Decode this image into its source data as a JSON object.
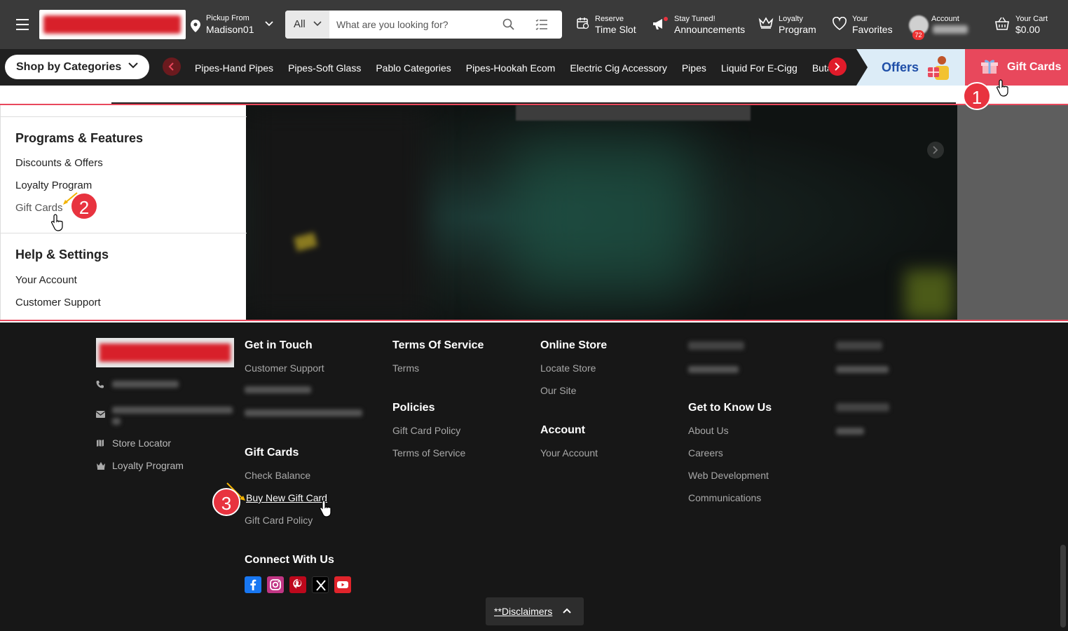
{
  "header": {
    "pickup_small": "Pickup From",
    "pickup_location": "Madison01",
    "search_category": "All",
    "search_placeholder": "What are you looking for?",
    "reserve_l1": "Reserve",
    "reserve_l2": "Time Slot",
    "announce_l1": "Stay Tuned!",
    "announce_l2": "Announcements",
    "loyalty_l1": "Loyalty",
    "loyalty_l2": "Program",
    "favorites_l1": "Your",
    "favorites_l2": "Favorites",
    "account_l1": "Account",
    "account_badge": "72",
    "cart_l1": "Your Cart",
    "cart_l2": "$0.00"
  },
  "catbar": {
    "shop_by": "Shop by Categories",
    "categories": [
      "Pipes-Hand Pipes",
      "Pipes-Soft Glass",
      "Pablo Categories",
      "Pipes-Hookah Ecom",
      "Electric Cig Accessory",
      "Pipes",
      "Liquid For E-Cigg",
      "Butane"
    ],
    "offers": "Offers",
    "gift_cards": "Gift Cards"
  },
  "sidebar": {
    "programs_title": "Programs & Features",
    "programs_links": [
      "Discounts & Offers",
      "Loyalty Program",
      "Gift Cards"
    ],
    "help_title": "Help & Settings",
    "help_links": [
      "Your Account",
      "Customer Support"
    ]
  },
  "footer": {
    "store_locator": "Store Locator",
    "loyalty_program": "Loyalty Program",
    "get_in_touch": "Get in Touch",
    "customer_support": "Customer Support",
    "gift_cards_title": "Gift Cards",
    "gift_cards_links": [
      "Check Balance",
      "Buy New Gift Card",
      "Gift Card Policy"
    ],
    "connect_title": "Connect With Us",
    "terms_title": "Terms Of Service",
    "terms_link": "Terms",
    "policies_title": "Policies",
    "policies_links": [
      "Gift Card Policy",
      "Terms of Service"
    ],
    "online_store_title": "Online Store",
    "online_store_links": [
      "Locate Store",
      "Our Site"
    ],
    "account_title": "Account",
    "account_link": "Your Account",
    "get_to_know_title": "Get to Know Us",
    "get_to_know_links": [
      "About Us",
      "Careers",
      "Web Development",
      "Communications"
    ],
    "disclaimers": "**Disclaimers"
  },
  "steps": [
    "1",
    "2",
    "3"
  ],
  "colors": {
    "accent_red": "#e8333f",
    "gift_pink": "#e8485c",
    "offers_blue": "#1f4fa8",
    "header_bg": "#3a3a3a",
    "footer_bg": "#171717"
  }
}
